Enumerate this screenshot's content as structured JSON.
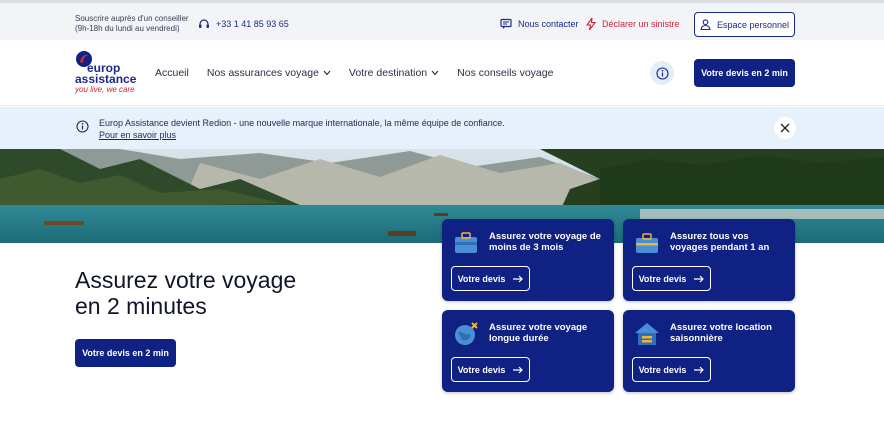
{
  "topbar": {
    "advice_line1": "Souscrire auprès d'un conseiller",
    "advice_line2": "(9h-18h du lundi au vendredi)",
    "phone": "+33 1 41 85 93 65",
    "contact": "Nous contacter",
    "claim": "Déclarer un sinistre",
    "account": "Espace personnel"
  },
  "logo": {
    "line1": "europ",
    "line2": "assistance",
    "tagline": "you live, we care"
  },
  "nav": {
    "items": [
      {
        "label": "Accueil"
      },
      {
        "label": "Nos assurances voyage"
      },
      {
        "label": "Votre destination"
      },
      {
        "label": "Nos conseils voyage"
      }
    ],
    "quote": "Votre devis en 2 min"
  },
  "banner": {
    "text": "Europ Assistance devient Redion - une nouvelle marque internationale, la même équipe de confiance.",
    "link": "Pour en savoir plus"
  },
  "hero": {
    "title_line1": "Assurez votre voyage",
    "title_line2": "en 2 minutes",
    "cta": "Votre devis en 2 min"
  },
  "cards": [
    {
      "title": "Assurez votre voyage de moins de 3 mois",
      "button": "Votre devis",
      "icon": "suitcase-icon"
    },
    {
      "title": "Assurez tous vos voyages pendant 1 an",
      "button": "Votre devis",
      "icon": "briefcase-icon"
    },
    {
      "title": "Assurez votre voyage longue durée",
      "button": "Votre devis",
      "icon": "globe-plane-icon"
    },
    {
      "title": "Assurez votre location saisonnière",
      "button": "Votre devis",
      "icon": "house-icon"
    }
  ],
  "colors": {
    "brand": "#0f2183",
    "accent_red": "#d0233a",
    "banner_bg": "#e6f1fb"
  }
}
